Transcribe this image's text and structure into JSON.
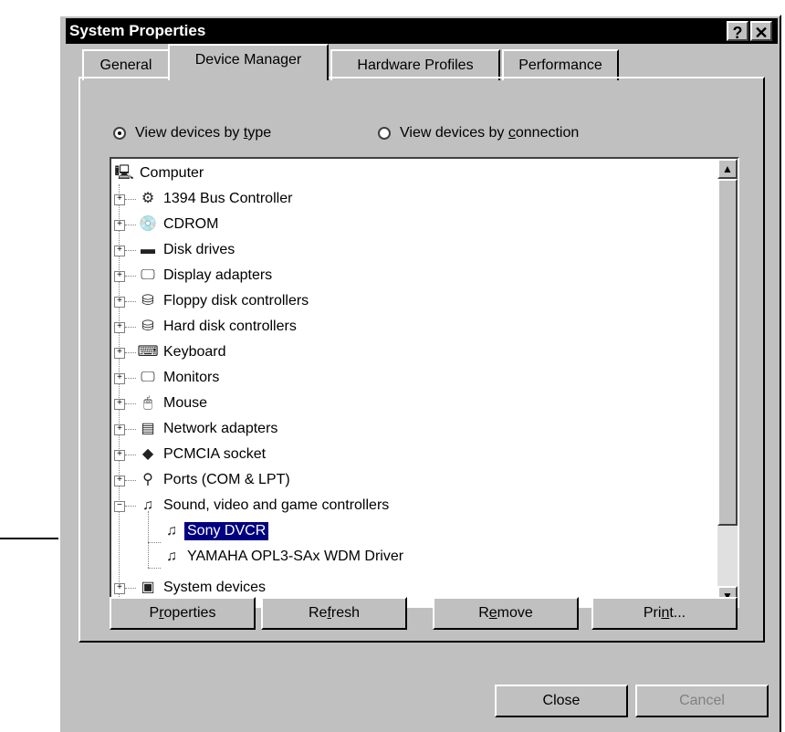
{
  "window": {
    "title": "System Properties",
    "help_label": "?",
    "close_label": "✕"
  },
  "tabs": [
    {
      "label": "General",
      "active": false
    },
    {
      "label": "Device Manager",
      "active": true
    },
    {
      "label": "Hardware Profiles",
      "active": false
    },
    {
      "label": "Performance",
      "active": false
    }
  ],
  "view_options": {
    "by_type": {
      "pre": "View devices by ",
      "underline": "t",
      "post": "ype",
      "selected": true
    },
    "by_connection": {
      "pre": "View devices by ",
      "underline": "c",
      "post": "onnection",
      "selected": false
    }
  },
  "device_tree": {
    "root": {
      "label": "Computer",
      "icon": "computer-icon"
    },
    "categories": [
      {
        "label": "1394 Bus Controller",
        "icon": "bus-controller-icon",
        "expanded": false
      },
      {
        "label": "CDROM",
        "icon": "cdrom-icon",
        "expanded": false
      },
      {
        "label": "Disk drives",
        "icon": "disk-drive-icon",
        "expanded": false
      },
      {
        "label": "Display adapters",
        "icon": "display-adapter-icon",
        "expanded": false
      },
      {
        "label": "Floppy disk controllers",
        "icon": "floppy-controller-icon",
        "expanded": false
      },
      {
        "label": "Hard disk controllers",
        "icon": "hard-disk-controller-icon",
        "expanded": false
      },
      {
        "label": "Keyboard",
        "icon": "keyboard-icon",
        "expanded": false
      },
      {
        "label": "Monitors",
        "icon": "monitor-icon",
        "expanded": false
      },
      {
        "label": "Mouse",
        "icon": "mouse-icon",
        "expanded": false
      },
      {
        "label": "Network adapters",
        "icon": "network-adapter-icon",
        "expanded": false
      },
      {
        "label": "PCMCIA socket",
        "icon": "pcmcia-icon",
        "expanded": false
      },
      {
        "label": "Ports (COM & LPT)",
        "icon": "port-icon",
        "expanded": false
      },
      {
        "label": "Sound, video and game controllers",
        "icon": "sound-controller-icon",
        "expanded": true,
        "children": [
          {
            "label": "Sony DVCR",
            "icon": "sound-device-icon",
            "selected": true
          },
          {
            "label": "YAMAHA OPL3-SAx WDM Driver",
            "icon": "sound-device-icon",
            "selected": false
          }
        ]
      },
      {
        "label": "System devices",
        "icon": "system-device-icon",
        "expanded": false
      }
    ]
  },
  "buttons": {
    "properties": {
      "pre": "P",
      "underline": "r",
      "post": "operties"
    },
    "refresh": {
      "pre": "Re",
      "underline": "f",
      "post": "resh"
    },
    "remove": {
      "pre": "R",
      "underline": "e",
      "post": "move"
    },
    "print": {
      "pre": "Pri",
      "underline": "n",
      "post": "t..."
    },
    "close": "Close",
    "cancel": "Cancel"
  }
}
